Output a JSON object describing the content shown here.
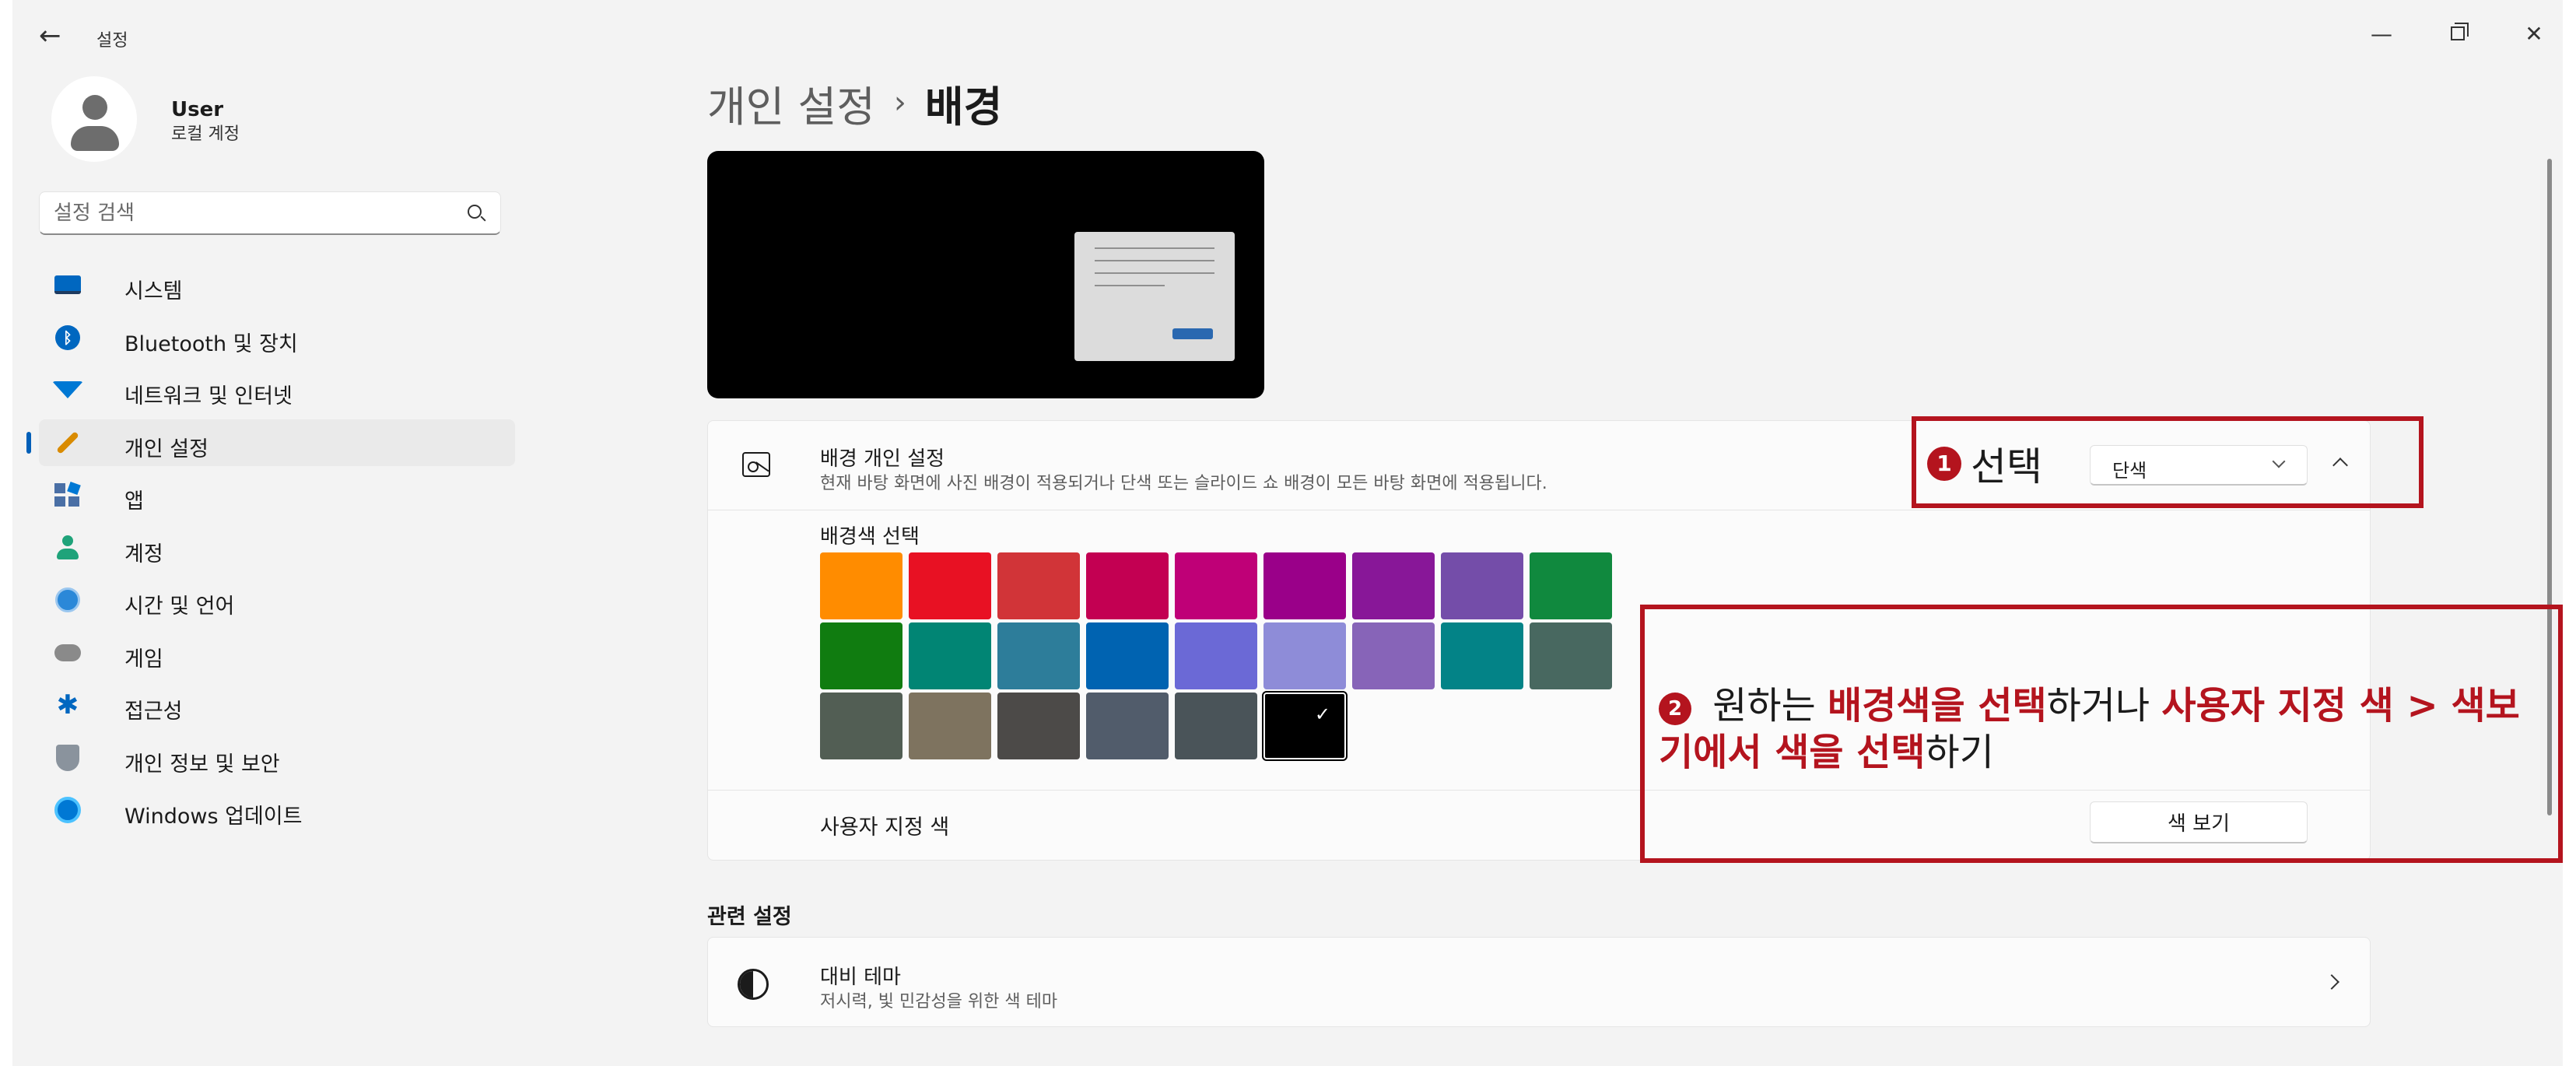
{
  "window": {
    "title": "설정",
    "back_icon": "back-arrow-icon",
    "controls": {
      "minimize": "—",
      "close": "✕"
    }
  },
  "profile": {
    "name": "User",
    "account_type": "로컬 계정"
  },
  "search": {
    "placeholder": "설정 검색"
  },
  "sidebar": {
    "items": [
      {
        "label": "시스템",
        "icon": "system-icon"
      },
      {
        "label": "Bluetooth 및 장치",
        "icon": "bluetooth-icon"
      },
      {
        "label": "네트워크 및 인터넷",
        "icon": "wifi-icon"
      },
      {
        "label": "개인 설정",
        "icon": "brush-icon",
        "active": true
      },
      {
        "label": "앱",
        "icon": "apps-icon"
      },
      {
        "label": "계정",
        "icon": "account-icon"
      },
      {
        "label": "시간 및 언어",
        "icon": "time-language-icon"
      },
      {
        "label": "게임",
        "icon": "gamepad-icon"
      },
      {
        "label": "접근성",
        "icon": "accessibility-icon"
      },
      {
        "label": "개인 정보 및 보안",
        "icon": "shield-icon"
      },
      {
        "label": "Windows 업데이트",
        "icon": "update-icon"
      }
    ]
  },
  "breadcrumb": {
    "parent": "개인 설정",
    "separator": "›",
    "current": "배경"
  },
  "background_card": {
    "title": "배경 개인 설정",
    "description": "현재 바탕 화면에 사진 배경이 적용되거나 단색 또는 슬라이드 쇼 배경이 모든 바탕 화면에 적용됩니다.",
    "dropdown_value": "단색",
    "palette_label": "배경색 선택",
    "swatches": [
      [
        "#ff8c00",
        "#e81123",
        "#d13438",
        "#c30052",
        "#bf0077",
        "#9a0089",
        "#881798",
        "#744da9",
        "#10893e"
      ],
      [
        "#107c10",
        "#018574",
        "#2d7d9a",
        "#0063b1",
        "#6b69d6",
        "#8e8cd8",
        "#8764b8",
        "#038387",
        "#486860"
      ],
      [
        "#525e54",
        "#7e735f",
        "#4c4a48",
        "#515c6b",
        "#4a5459",
        "#000000"
      ]
    ],
    "selected_swatch": "#000000",
    "custom_color_label": "사용자 지정 색",
    "view_colors_button": "색 보기"
  },
  "related": {
    "heading": "관련 설정",
    "contrast_title": "대비 테마",
    "contrast_desc": "저시력, 빛 민감성을 위한 색 테마"
  },
  "annotations": {
    "step1_num": "①",
    "step1_label": "선택",
    "step2_num": "②",
    "step2_parts": [
      " 원하는 ",
      "배경색을 선택",
      "하거나 ",
      "사용자 지정 색 > 색보기에서 색을 선택",
      "하기"
    ],
    "accent": "#b4141e"
  }
}
